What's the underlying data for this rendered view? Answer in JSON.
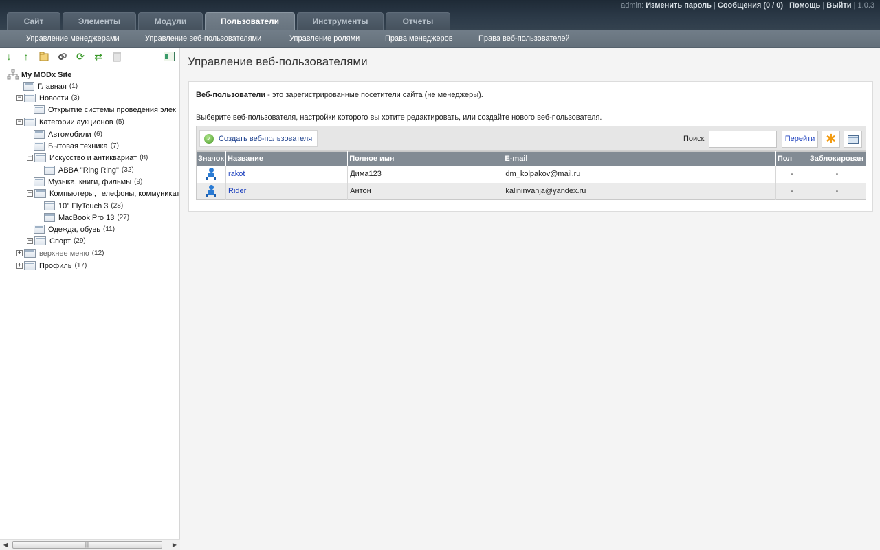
{
  "header": {
    "tabs": [
      "Сайт",
      "Элементы",
      "Модули",
      "Пользователи",
      "Инструменты",
      "Отчеты"
    ],
    "active_tab": "Пользователи",
    "user": "admin:",
    "change_password": "Изменить пароль",
    "messages": "Сообщения (0 / 0)",
    "help": "Помощь",
    "logout": "Выйти",
    "separator": "|",
    "version": "1.0.3"
  },
  "subnav": [
    "Управление менеджерами",
    "Управление веб-пользователями",
    "Управление ролями",
    "Права менеджеров",
    "Права веб-пользователей"
  ],
  "tree_toolbar": {
    "icons": [
      "expand-tree-icon",
      "collapse-tree-icon",
      "new-document-icon",
      "new-weblink-icon",
      "refresh-icon",
      "sort-icon",
      "purge-icon",
      "hide-panel-icon"
    ]
  },
  "tree": {
    "root": "My MODx Site",
    "nodes": [
      {
        "label": "Главная",
        "count": "(1)"
      },
      {
        "label": "Новости",
        "count": "(3)"
      },
      {
        "label": "Открытие системы проведения элек",
        "count": ""
      },
      {
        "label": "Категории аукционов",
        "count": "(5)"
      },
      {
        "label": "Автомобили",
        "count": "(6)"
      },
      {
        "label": "Бытовая техника",
        "count": "(7)"
      },
      {
        "label": "Искусство и антиквариат",
        "count": "(8)"
      },
      {
        "label": "ABBA \"Ring Ring\"",
        "count": "(32)"
      },
      {
        "label": "Музыка, книги, фильмы",
        "count": "(9)"
      },
      {
        "label": "Компьютеры, телефоны, коммуникат",
        "count": ""
      },
      {
        "label": "10\" FlyTouch 3",
        "count": "(28)"
      },
      {
        "label": "MacBook Pro 13",
        "count": "(27)"
      },
      {
        "label": "Одежда, обувь",
        "count": "(11)"
      },
      {
        "label": "Спорт",
        "count": "(29)"
      },
      {
        "label": "верхнее меню",
        "count": "(12)"
      },
      {
        "label": "Профиль",
        "count": "(17)"
      }
    ],
    "expand_symbols": {
      "minus": "−",
      "plus": "+"
    }
  },
  "main": {
    "title": "Управление веб-пользователями",
    "intro_bold": "Веб-пользователи",
    "intro_rest": " - это зарегистрированные посетители сайта (не менеджеры).",
    "hint": "Выберите веб-пользователя, настройки которого вы хотите редактировать, или создайте нового веб-пользователя.",
    "create_button": "Создать веб-пользователя",
    "search_label": "Поиск",
    "search_value": "",
    "go_button": "Перейти",
    "columns": [
      "Значок",
      "Название",
      "Полное имя",
      "E-mail",
      "Пол",
      "Заблокирован"
    ],
    "rows": [
      {
        "name": "rakot",
        "fullname": "Дима123",
        "email": "dm_kolpakov@mail.ru",
        "gender": "-",
        "blocked": "-"
      },
      {
        "name": "Rider",
        "fullname": "Антон",
        "email": "kalininvanja@yandex.ru",
        "gender": "-",
        "blocked": "-"
      }
    ]
  },
  "colors": {
    "topbar": "#2c3a48",
    "subbar": "#6b7782",
    "header_row": "#828b94",
    "link": "#1a3ebd"
  }
}
